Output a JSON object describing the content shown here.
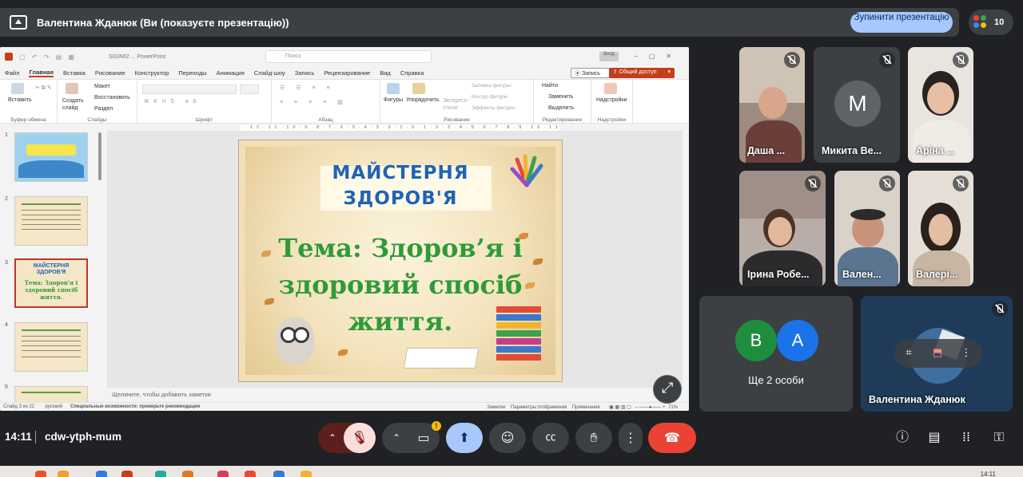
{
  "banner": {
    "title": "Валентина Жданюк (Ви (показуєте презентацію))",
    "stop_button": "Зупинити презентацію",
    "people_count": "10"
  },
  "powerpoint": {
    "doc_title": "SIGIMI2 ... PowerPoint",
    "search_placeholder": "Поиск",
    "sign_in": "Вход",
    "menu": [
      "Файл",
      "Главная",
      "Вставка",
      "Рисование",
      "Конструктор",
      "Переходы",
      "Анимация",
      "Слайд-шоу",
      "Запись",
      "Рецензирование",
      "Вид",
      "Справка"
    ],
    "record_button": "Запись",
    "share_button": "Общий доступ",
    "ribbon": {
      "paste": "Вставить",
      "clipboard": "Буфер обмена",
      "create_slide": "Создать слайд",
      "layout": "Макет",
      "reset": "Восстановить",
      "section": "Раздел",
      "slides": "Слайды",
      "font": "Шрифт",
      "paragraph": "Абзац",
      "shapes": "Фигуры",
      "arrange": "Упорядочить",
      "quick_styles": "Экспресс-стили",
      "fill": "Заливка фигуры",
      "outline": "Контур фигуры",
      "effects": "Эффекты фигуры",
      "drawing": "Рисование",
      "find": "Найти",
      "replace": "Заменить",
      "select": "Выделить",
      "editing": "Редактирование",
      "addins": "Надстройки",
      "addins_group": "Надстройки"
    },
    "ruler_text": "·12·11·10·9·8·7·6·5·4·3·2·1·0·1·2·3·4·5·6·7·8·9·10·11·12·",
    "thumb_numbers": [
      "1",
      "2",
      "3",
      "4",
      "5"
    ],
    "thumb3_title": "МАЙСТЕРНЯ ЗДОРОВ'Я",
    "thumb3_body": "Тема: Здоров'я і здоровий спосіб життя.",
    "slide": {
      "heading1": "МАЙСТЕРНЯ",
      "heading2": "ЗДОРОВ'Я",
      "body": "Тема: Здоров’я і здоровий спосіб життя."
    },
    "notes_placeholder": "Щелкните, чтобы добавить заметки",
    "status": {
      "slide_of": "Слайд 3 из 22",
      "language": "русский",
      "accessibility": "Специальные возможности: проверьте рекомендации",
      "notes": "Заметки",
      "display": "Параметры отображения",
      "comments": "Примечания",
      "zoom": "71%"
    }
  },
  "participants": [
    {
      "name": "Даша ..."
    },
    {
      "name": "Микита Ве...",
      "initial": "M"
    },
    {
      "name": "Аріна ..."
    },
    {
      "name": "Ірина Робе..."
    },
    {
      "name": "Вален..."
    },
    {
      "name": "Валері..."
    }
  ],
  "more_people": {
    "initials": [
      "B",
      "A"
    ],
    "label": "Ще 2 особи"
  },
  "self": {
    "name": "Валентина Жданюк"
  },
  "bottom": {
    "time": "14:11",
    "meeting_code": "cdw-ytph-mum"
  },
  "taskbar": {
    "time": "14:11"
  },
  "colors": {
    "end_call": "#ea4335",
    "present_active": "#a8c7fa",
    "mic_off": "#f9dedc",
    "accent_ppt": "#c43e1c"
  }
}
